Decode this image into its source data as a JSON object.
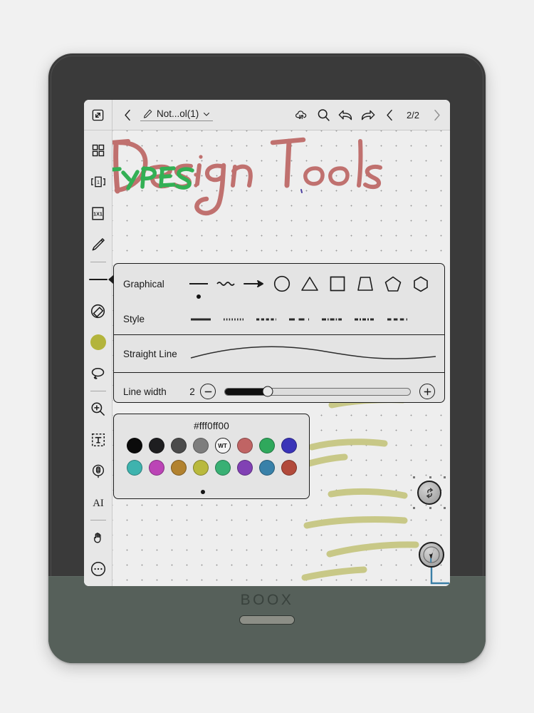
{
  "device": {
    "brand": "BOOX",
    "frame_color": "#3a3a3a",
    "chin_color": "#56605a"
  },
  "topbar": {
    "expand_icon": "expand-arrows-icon",
    "back_icon": "chevron-left-icon",
    "pen_icon": "pencil-icon",
    "doc_title": "Not...ol(1)",
    "dropdown_icon": "chevron-down-icon",
    "cloud_sync_icon": "cloud-sync-icon",
    "search_icon": "search-icon",
    "undo_icon": "undo-arrow-icon",
    "redo_icon": "redo-arrow-icon",
    "prev_page_icon": "chevron-left-icon",
    "page_indicator": "2/2",
    "next_page_icon": "chevron-right-icon"
  },
  "rail": {
    "items": [
      {
        "name": "grid-layout-icon",
        "label": "Grid layout"
      },
      {
        "name": "single-page-icon",
        "label": "Single page"
      },
      {
        "name": "one-by-one-icon",
        "label": "1X1 scale"
      },
      {
        "name": "pencil-tool-icon",
        "label": "Pencil"
      },
      {
        "name": "line-tool-icon",
        "label": "Shapes / Line",
        "active": true
      },
      {
        "name": "eraser-tool-icon",
        "label": "Eraser"
      },
      {
        "name": "color-swatch-icon",
        "label": "Color",
        "color": "#b3b43c"
      },
      {
        "name": "lasso-tool-icon",
        "label": "Lasso select"
      },
      {
        "name": "zoom-tool-icon",
        "label": "Zoom"
      },
      {
        "name": "text-box-tool-icon",
        "label": "Text box"
      },
      {
        "name": "microphone-tool-icon",
        "label": "Voice record"
      },
      {
        "name": "ai-tool-icon",
        "label": "AI"
      },
      {
        "name": "hand-tool-icon",
        "label": "Hand / pan"
      },
      {
        "name": "more-options-icon",
        "label": "More"
      }
    ]
  },
  "shape_panel": {
    "graphical_label": "Graphical",
    "graphical_items": [
      {
        "name": "straight-line-shape",
        "selected": true
      },
      {
        "name": "wavy-line-shape",
        "selected": false
      },
      {
        "name": "arrow-shape",
        "selected": false
      },
      {
        "name": "circle-shape",
        "selected": false
      },
      {
        "name": "triangle-shape",
        "selected": false
      },
      {
        "name": "square-shape",
        "selected": false
      },
      {
        "name": "trapezoid-shape",
        "selected": false
      },
      {
        "name": "pentagon-shape",
        "selected": false
      },
      {
        "name": "hexagon-shape",
        "selected": false
      }
    ],
    "style_label": "Style",
    "style_items": [
      {
        "name": "solid-line-style",
        "dash": "none"
      },
      {
        "name": "dotted-line-style",
        "dash": "1.5 2"
      },
      {
        "name": "short-dash-style",
        "dash": "4 2.5"
      },
      {
        "name": "long-dash-style",
        "dash": "8 5"
      },
      {
        "name": "dash-dot-style",
        "dash": "6 2 1.5 2"
      },
      {
        "name": "dash-dot-dot-style",
        "dash": "5 2 2 2"
      },
      {
        "name": "wide-dash-style",
        "dash": "5 3"
      }
    ],
    "straight_line_label": "Straight Line",
    "line_width_label": "Line width",
    "line_width_value": "2",
    "minus_icon": "minus-circle-icon",
    "plus_icon": "plus-circle-icon",
    "slider_percent": 23
  },
  "color_panel": {
    "hex_value": "#fff0ff00",
    "row1": [
      {
        "name": "swatch-black",
        "hex": "#0b0b0b"
      },
      {
        "name": "swatch-near-black",
        "hex": "#1e1e20"
      },
      {
        "name": "swatch-dark-gray",
        "hex": "#4b4b4b"
      },
      {
        "name": "swatch-gray",
        "hex": "#7d7d7d"
      },
      {
        "name": "swatch-white-wt",
        "hex": "#f4f4f4",
        "label": "WT"
      },
      {
        "name": "swatch-red",
        "hex": "#c06464"
      },
      {
        "name": "swatch-green",
        "hex": "#2fa85c"
      },
      {
        "name": "swatch-blue",
        "hex": "#3a34b8"
      }
    ],
    "row2": [
      {
        "name": "swatch-teal",
        "hex": "#3eb3ae"
      },
      {
        "name": "swatch-magenta",
        "hex": "#bb44b6"
      },
      {
        "name": "swatch-ochre",
        "hex": "#b2822f"
      },
      {
        "name": "swatch-olive",
        "hex": "#b9b93d"
      },
      {
        "name": "swatch-emerald",
        "hex": "#39b074"
      },
      {
        "name": "swatch-purple",
        "hex": "#8141b4"
      },
      {
        "name": "swatch-steel-blue",
        "hex": "#3981a9"
      },
      {
        "name": "swatch-brick",
        "hex": "#b24a3b"
      }
    ],
    "selected_index": 3,
    "selected_row": 2
  },
  "canvas": {
    "title_text": "Design Tools",
    "title_color": "#c0716f",
    "subtitle_text": "TYPES:",
    "subtitle_color": "#33b055",
    "stroke_color": "#c8c887",
    "strokes_count": 7
  },
  "floating": {
    "sync_button": "sync-refresh-icon",
    "pen_button": "pen-cursor-icon"
  }
}
